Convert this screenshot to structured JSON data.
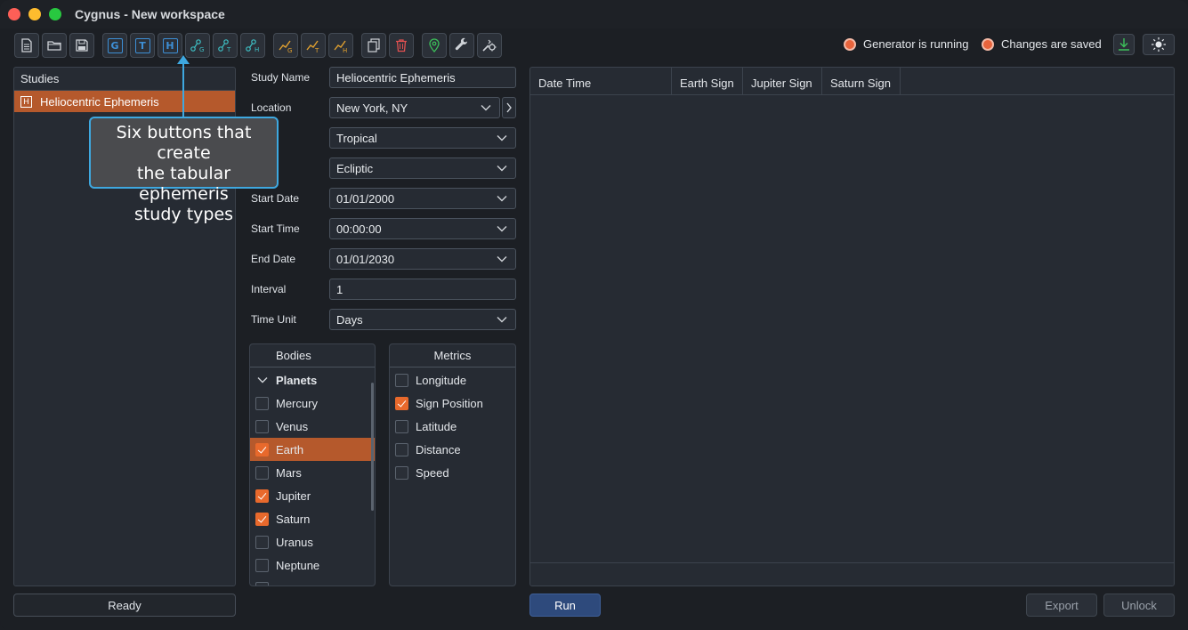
{
  "window": {
    "title": "Cygnus - New workspace"
  },
  "toolbar": {
    "study_letters": {
      "g": "G",
      "t": "T",
      "h": "H"
    },
    "graph_letters": {
      "g": "G",
      "t": "T",
      "h": "H"
    }
  },
  "status": {
    "generator": "Generator is running",
    "changes": "Changes are saved"
  },
  "studies": {
    "header": "Studies",
    "items": [
      {
        "badge": "H",
        "label": "Heliocentric Ephemeris"
      }
    ]
  },
  "form": {
    "study_name": {
      "label": "Study Name",
      "value": "Heliocentric Ephemeris"
    },
    "location": {
      "label": "Location",
      "value": "New York, NY"
    },
    "zodiac": {
      "label": "c",
      "value": "Tropical"
    },
    "plane": {
      "label": "lane",
      "value": "Ecliptic"
    },
    "start_date": {
      "label": "Start Date",
      "value": "01/01/2000"
    },
    "start_time": {
      "label": "Start Time",
      "value": "00:00:00"
    },
    "end_date": {
      "label": "End Date",
      "value": "01/01/2030"
    },
    "interval": {
      "label": "Interval",
      "value": "1"
    },
    "time_unit": {
      "label": "Time Unit",
      "value": "Days"
    }
  },
  "bodies": {
    "header": "Bodies",
    "group": "Planets",
    "items": [
      {
        "label": "Mercury",
        "checked": false
      },
      {
        "label": "Venus",
        "checked": false
      },
      {
        "label": "Earth",
        "checked": true
      },
      {
        "label": "Mars",
        "checked": false
      },
      {
        "label": "Jupiter",
        "checked": true
      },
      {
        "label": "Saturn",
        "checked": true
      },
      {
        "label": "Uranus",
        "checked": false
      },
      {
        "label": "Neptune",
        "checked": false
      }
    ]
  },
  "metrics": {
    "header": "Metrics",
    "items": [
      {
        "label": "Longitude",
        "checked": false
      },
      {
        "label": "Sign Position",
        "checked": true
      },
      {
        "label": "Latitude",
        "checked": false
      },
      {
        "label": "Distance",
        "checked": false
      },
      {
        "label": "Speed",
        "checked": false
      }
    ]
  },
  "table": {
    "columns": [
      "Date Time",
      "Earth Sign",
      "Jupiter Sign",
      "Saturn Sign"
    ]
  },
  "buttons": {
    "ready": "Ready",
    "run": "Run",
    "export": "Export",
    "unlock": "Unlock"
  },
  "callout": {
    "line1": "Six buttons that create",
    "line2": "the tabular ephemeris",
    "line3": "study types"
  },
  "colors": {
    "accent": "#b5592c",
    "checkbox": "#e8692c",
    "callout_border": "#3ea8e0",
    "run": "#2e4a7c"
  }
}
